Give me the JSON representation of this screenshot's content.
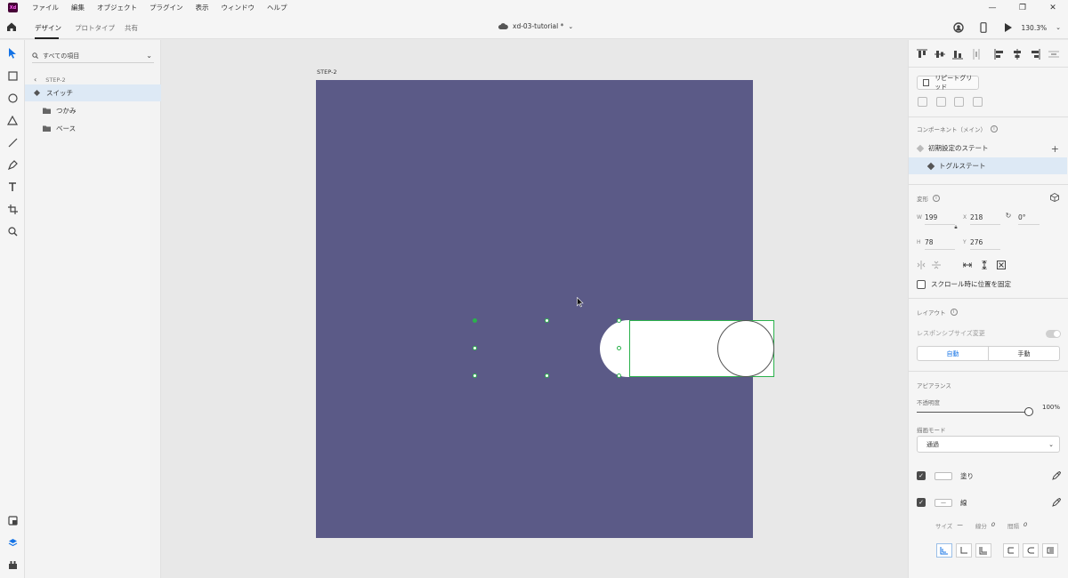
{
  "app": {
    "logo_text": "Xd"
  },
  "menu": [
    "ファイル",
    "編集",
    "オブジェクト",
    "プラグイン",
    "表示",
    "ウィンドウ",
    "ヘルプ"
  ],
  "window_controls": {
    "minimize": "—",
    "restore": "❐",
    "close": "✕"
  },
  "tabs": {
    "design": "デザイン",
    "prototype": "プロトタイプ",
    "share": "共有"
  },
  "document": {
    "title": "xd-03-tutorial *"
  },
  "toolbar": {
    "zoom": "130.3%"
  },
  "layers": {
    "search_placeholder": "すべての項目",
    "breadcrumb": "STEP-2",
    "items": [
      {
        "label": "スイッチ",
        "selected": true,
        "icon": "component-icon"
      },
      {
        "label": "つかみ",
        "selected": false,
        "icon": "folder-icon"
      },
      {
        "label": "ベース",
        "selected": false,
        "icon": "folder-icon"
      }
    ]
  },
  "canvas": {
    "artboard_label": "STEP-2",
    "artboard_color": "#5b5a87"
  },
  "properties": {
    "repeat_grid": "リピートグリッド",
    "component_section": "コンポーネント（メイン）",
    "states": [
      {
        "label": "初期設定のステート",
        "selected": false
      },
      {
        "label": "トグルステート",
        "selected": true
      }
    ],
    "transform_section": "変形",
    "w_label": "W",
    "w_value": "199",
    "x_label": "X",
    "x_value": "218",
    "rotation_value": "0°",
    "h_label": "H",
    "h_value": "78",
    "y_label": "Y",
    "y_value": "276",
    "scroll_fix": "スクロール時に位置を固定",
    "layout_section": "レイアウト",
    "responsive_resize": "レスポンシブサイズ変更",
    "resize_auto": "自動",
    "resize_manual": "手動",
    "appearance_section": "アピアランス",
    "opacity_label": "不透明度",
    "opacity_value": "100%",
    "blend_label": "描画モード",
    "blend_value": "通過",
    "fill_label": "塗り",
    "stroke_label": "線",
    "stroke_swatch": "—",
    "size_label": "サイズ",
    "size_value": "—",
    "dash_label": "線分",
    "dash_value": "0",
    "gap_label": "間隔",
    "gap_value": "0"
  },
  "colors": {
    "selection": "#2bb24c",
    "accent": "#1473e6"
  }
}
